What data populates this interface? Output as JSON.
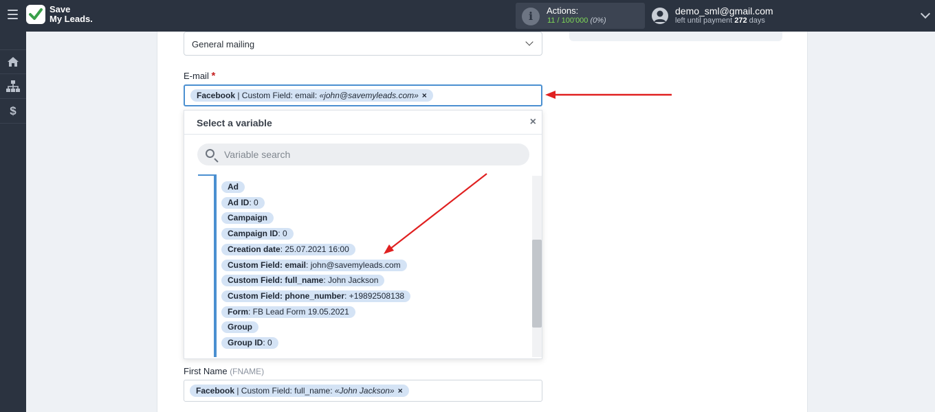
{
  "brand": {
    "line1": "Save",
    "line2": "My Leads."
  },
  "header": {
    "actions_label": "Actions:",
    "actions_used": "11",
    "actions_limit": "100'000",
    "actions_percent": "(0%)",
    "user_email": "demo_sml@gmail.com",
    "payment_prefix": "left until payment",
    "payment_days": "272",
    "payment_suffix": "days"
  },
  "form": {
    "mailing_select_value": "General mailing",
    "email_label": "E-mail",
    "required_mark": "*",
    "email_chip": {
      "source": "Facebook",
      "field": "| Custom Field: email:",
      "value": "«john@savemyleads.com»",
      "remove": "×"
    },
    "first_name_label": "First Name",
    "first_name_hint": "(FNAME)",
    "first_name_chip": {
      "source": "Facebook",
      "field": "| Custom Field: full_name:",
      "value": "«John Jackson»",
      "remove": "×"
    }
  },
  "variable_dropdown": {
    "title": "Select a variable",
    "close": "×",
    "search_placeholder": "Variable search",
    "items": [
      {
        "name": "Ad",
        "value": ""
      },
      {
        "name": "Ad ID",
        "value": ": 0"
      },
      {
        "name": "Campaign",
        "value": ""
      },
      {
        "name": "Campaign ID",
        "value": ": 0"
      },
      {
        "name": "Creation date",
        "value": ": 25.07.2021 16:00"
      },
      {
        "name": "Custom Field: email",
        "value": ": john@savemyleads.com"
      },
      {
        "name": "Custom Field: full_name",
        "value": ": John Jackson"
      },
      {
        "name": "Custom Field: phone_number",
        "value": ": +19892508138"
      },
      {
        "name": "Form",
        "value": ": FB Lead Form 19.05.2021"
      },
      {
        "name": "Group",
        "value": ""
      },
      {
        "name": "Group ID",
        "value": ": 0"
      }
    ]
  },
  "colors": {
    "topbar": "#2b3340",
    "accent": "#4a8fd0",
    "chip": "#d4e3f5",
    "annotation_arrow": "#e02020"
  }
}
